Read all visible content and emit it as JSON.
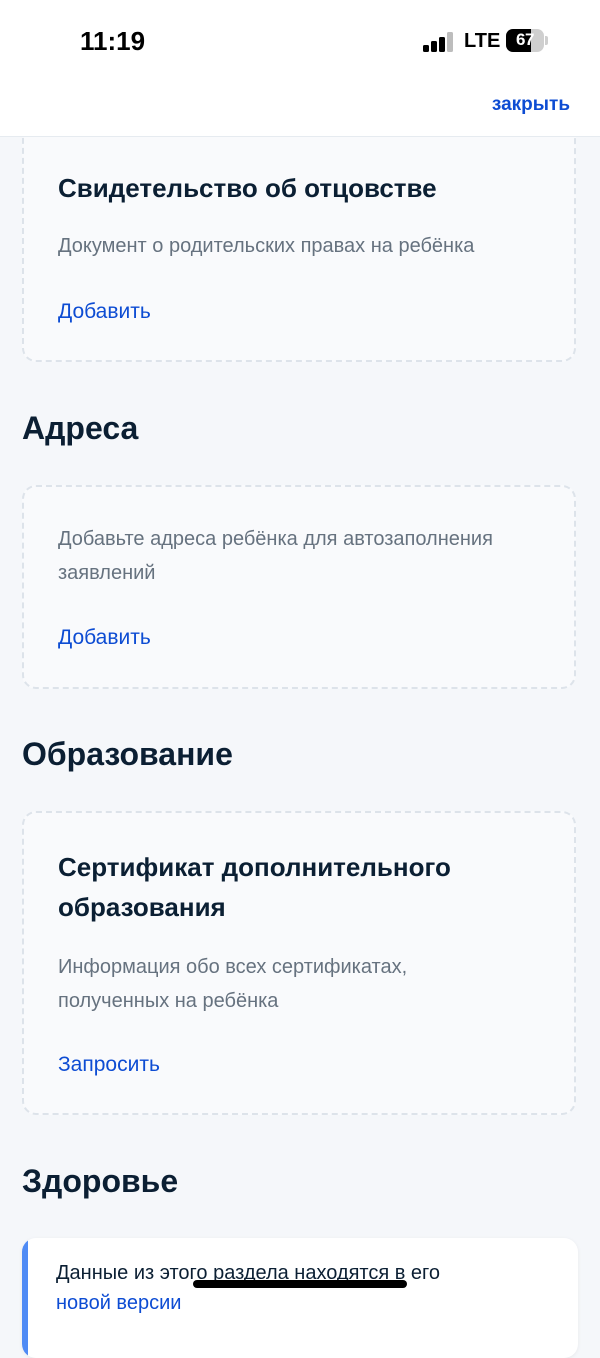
{
  "status_bar": {
    "time": "11:19",
    "network": "LTE",
    "battery": "67",
    "battery_level": 0.67
  },
  "header": {
    "close_label": "закрыть"
  },
  "cards": {
    "paternity": {
      "title": "Свидетельство об отцовстве",
      "description": "Документ о родительских правах на ребёнка",
      "action": "Добавить"
    },
    "addresses": {
      "description_line1": "Добавьте адреса ребёнка для автозаполнения",
      "description_line2": "заявлений",
      "action": "Добавить"
    },
    "certificate": {
      "title_line1": "Сертификат дополнительного",
      "title_line2": "образования",
      "description_line1": "Информация обо всех сертификатах,",
      "description_line2": "полученных на ребёнка",
      "action": "Запросить"
    }
  },
  "sections": {
    "addresses": "Адреса",
    "education": "Образование",
    "health": "Здоровье"
  },
  "health_info": {
    "text": "Данные из этого раздела находятся в его",
    "link": "новой версии"
  },
  "colors": {
    "accent": "#0d4cd3",
    "info_bar": "#4f8bf5",
    "background": "#f5f7fa"
  }
}
